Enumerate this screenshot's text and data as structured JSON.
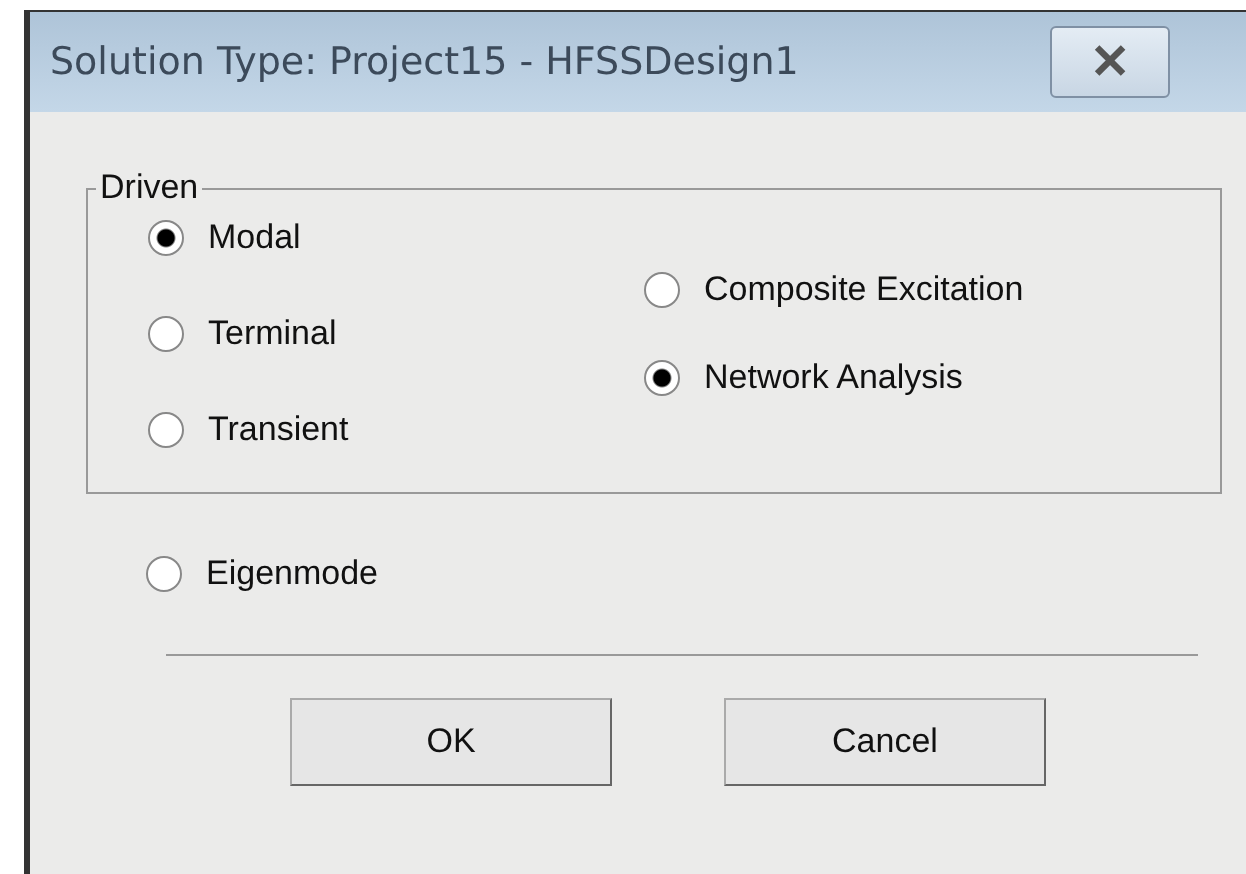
{
  "window": {
    "title": "Solution Type: Project15 - HFSSDesign1",
    "close": "✕"
  },
  "driven": {
    "label": "Driven",
    "left": [
      {
        "label": "Modal",
        "selected": true
      },
      {
        "label": "Terminal",
        "selected": false
      },
      {
        "label": "Transient",
        "selected": false
      }
    ],
    "right": [
      {
        "label": "Composite Excitation",
        "selected": false
      },
      {
        "label": "Network Analysis",
        "selected": true
      }
    ]
  },
  "eigenmode": {
    "label": "Eigenmode",
    "selected": false
  },
  "buttons": [
    "OK",
    "Cancel"
  ]
}
